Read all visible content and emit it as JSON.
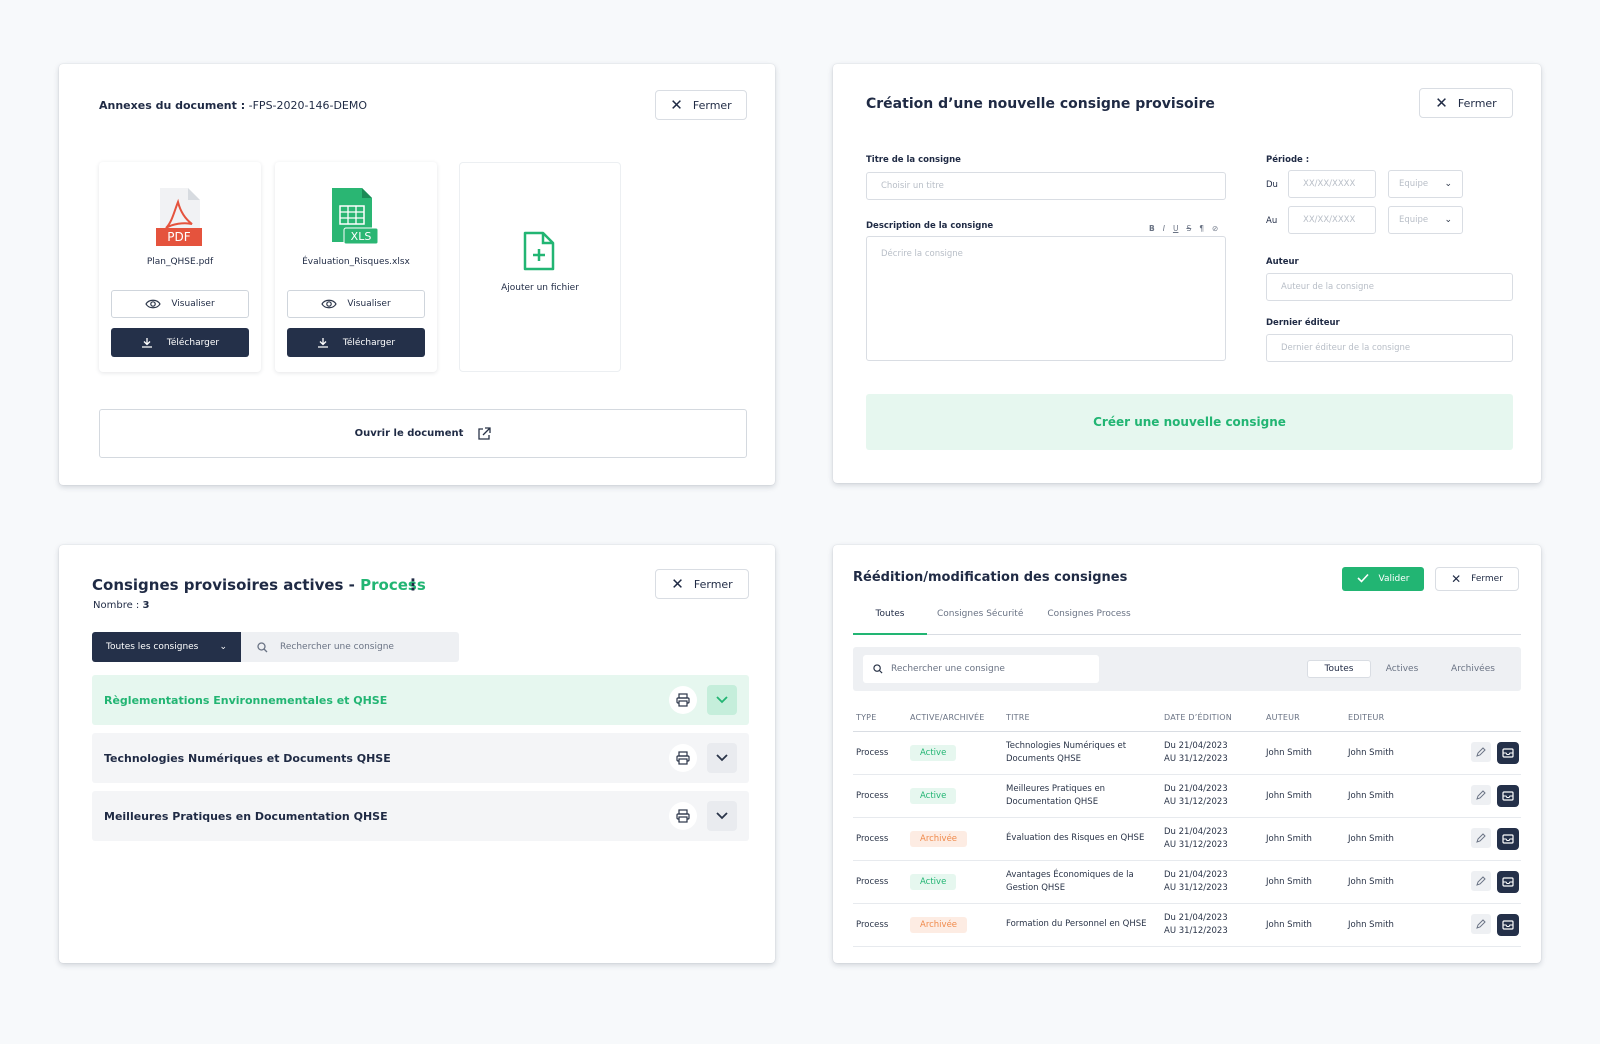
{
  "annexes": {
    "title_label": "Annexes du document :",
    "title_ref": "-FPS-2020-146-DEMO",
    "close_label": "Fermer",
    "files": [
      {
        "name": "Plan_QHSE.pdf",
        "type_label": "PDF",
        "icon": "pdf-file-icon",
        "view_label": "Visualiser",
        "download_label": "Télécharger"
      },
      {
        "name": "Évaluation_Risques.xlsx",
        "type_label": "XLS",
        "icon": "xls-file-icon",
        "view_label": "Visualiser",
        "download_label": "Télécharger"
      }
    ],
    "add_file_label": "Ajouter un fichier",
    "open_document_label": "Ouvrir le document"
  },
  "creation": {
    "heading": "Création d’une nouvelle consigne provisoire",
    "close_label": "Fermer",
    "title_field": {
      "label": "Titre de la consigne",
      "placeholder": "Choisir un titre"
    },
    "description_field": {
      "label": "Description de la consigne",
      "placeholder": "Décrire la consigne",
      "toolbar": [
        "B",
        "I",
        "U",
        "S",
        "¶",
        "⊘"
      ]
    },
    "period": {
      "label": "Période :",
      "from_label": "Du",
      "to_label": "Au",
      "date_placeholder": "XX/XX/XXXX",
      "team_placeholder": "Equipe"
    },
    "author_field": {
      "label": "Auteur",
      "placeholder": "Auteur de la consigne"
    },
    "editor_field": {
      "label": "Dernier éditeur",
      "placeholder": "Dernier éditeur de la consigne"
    },
    "submit_label": "Créer une nouvelle consigne"
  },
  "active_list": {
    "heading": "Consignes provisoires actives - ",
    "heading_accent": "Process",
    "count_label": "Nombre :",
    "count_value": "3",
    "close_label": "Fermer",
    "filter_selected": "Toutes les consignes",
    "search_placeholder": "Rechercher une consigne",
    "items": [
      {
        "title": "Règlementations Environnementales et QHSE",
        "expanded": true
      },
      {
        "title": "Technologies Numériques et Documents QHSE",
        "expanded": false
      },
      {
        "title": "Meilleures Pratiques en Documentation QHSE",
        "expanded": false
      }
    ]
  },
  "reedition": {
    "heading": "Réédition/modification des consignes",
    "validate_label": "Valider",
    "close_label": "Fermer",
    "tabs": [
      "Toutes",
      "Consignes Sécurité",
      "Consignes Process"
    ],
    "selected_tab": "Toutes",
    "search_placeholder": "Rechercher une consigne",
    "status_filters": [
      "Toutes",
      "Actives",
      "Archivées"
    ],
    "selected_status_filter": "Toutes",
    "columns": [
      "TYPE",
      "ACTIVE/ARCHIVÉE",
      "TITRE",
      "DATE D’ÉDITION",
      "AUTEUR",
      "EDITEUR"
    ],
    "rows": [
      {
        "type": "Process",
        "status": "Active",
        "status_kind": "active",
        "title": "Technologies Numériques et Documents QHSE",
        "date_from": "Du 21/04/2023",
        "date_to": "AU 31/12/2023",
        "author": "John Smith",
        "editor": "John Smith"
      },
      {
        "type": "Process",
        "status": "Active",
        "status_kind": "active",
        "title": "Meilleures Pratiques en Documentation QHSE",
        "date_from": "Du 21/04/2023",
        "date_to": "AU 31/12/2023",
        "author": "John Smith",
        "editor": "John Smith"
      },
      {
        "type": "Process",
        "status": "Archivée",
        "status_kind": "archived",
        "title": "Évaluation des Risques en QHSE",
        "date_from": "Du 21/04/2023",
        "date_to": "AU 31/12/2023",
        "author": "John Smith",
        "editor": "John Smith"
      },
      {
        "type": "Process",
        "status": "Active",
        "status_kind": "active",
        "title": "Avantages Économiques de la Gestion QHSE",
        "date_from": "Du 21/04/2023",
        "date_to": "AU 31/12/2023",
        "author": "John Smith",
        "editor": "John Smith"
      },
      {
        "type": "Process",
        "status": "Archivée",
        "status_kind": "archived",
        "title": "Formation du Personnel en QHSE",
        "date_from": "Du 21/04/2023",
        "date_to": "AU 31/12/2023",
        "author": "John Smith",
        "editor": "John Smith"
      }
    ]
  },
  "colors": {
    "accent_green": "#22b573",
    "navy": "#243049",
    "archived_orange": "#f08a4b",
    "pdf_red": "#e5533d"
  }
}
